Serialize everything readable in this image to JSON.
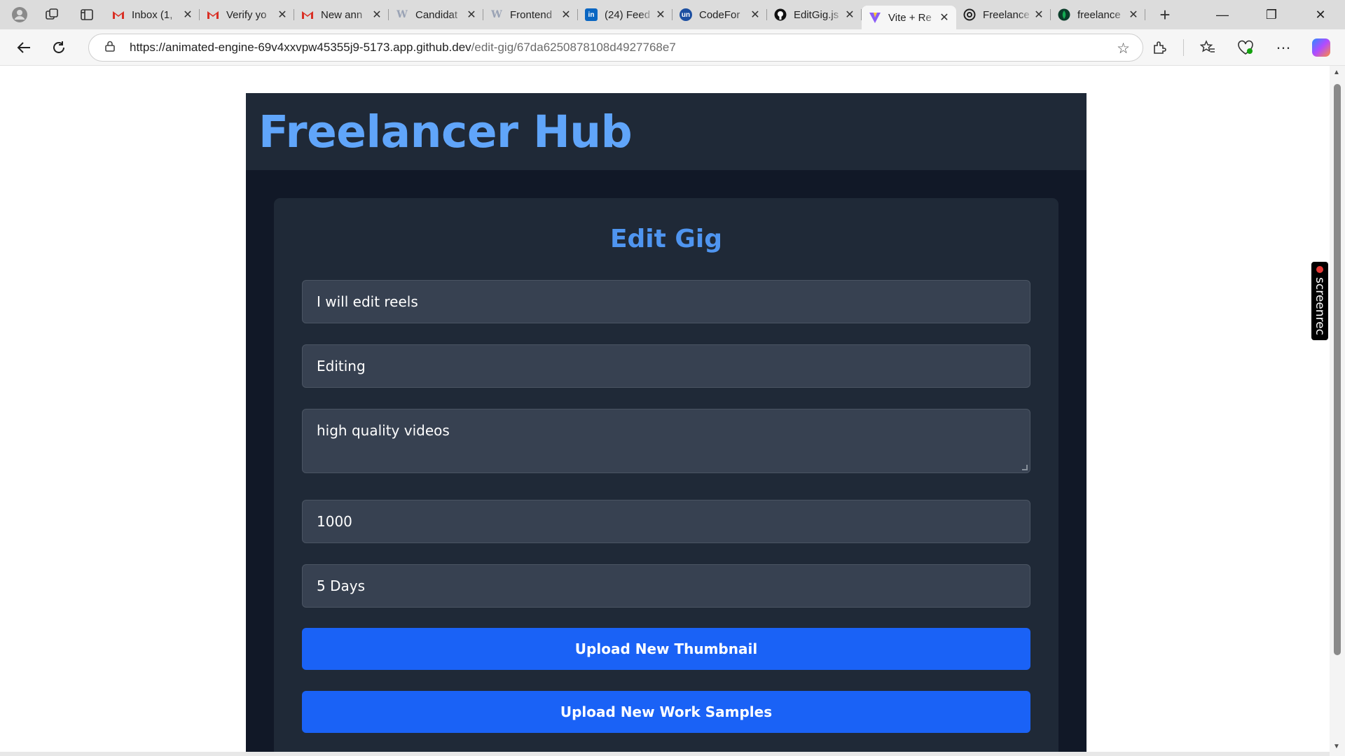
{
  "browser": {
    "tabs": [
      {
        "title": "Inbox (1,",
        "icon": "gmail-icon",
        "color": "#d93025"
      },
      {
        "title": "Verify yo",
        "icon": "gmail-icon",
        "color": "#d93025"
      },
      {
        "title": "New ann",
        "icon": "gmail-icon",
        "color": "#d93025"
      },
      {
        "title": "Candidat",
        "icon": "w-icon",
        "color": "#9aa3b5"
      },
      {
        "title": "Frontend",
        "icon": "w-icon",
        "color": "#9aa3b5"
      },
      {
        "title": "(24) Feed",
        "icon": "linkedin-icon",
        "color": "#0a66c2"
      },
      {
        "title": "CodeFor",
        "icon": "unstop-icon",
        "color": "#1c4fa1"
      },
      {
        "title": "EditGig.js",
        "icon": "github-icon",
        "color": "#111111"
      },
      {
        "title": "Vite + Re",
        "icon": "vite-icon",
        "color": "#8b5cf6"
      },
      {
        "title": "Freelance",
        "icon": "openai-icon",
        "color": "#222222"
      },
      {
        "title": "freelance",
        "icon": "mongodb-icon",
        "color": "#13aa52"
      }
    ],
    "active_tab_index": 8,
    "url_host": "https://animated-engine-69v4xxvpw45355j9-5173.app.github.dev",
    "url_path": "/edit-gig/67da6250878108d4927768e7",
    "screenrec_label": "screenrec"
  },
  "app": {
    "brand": "Freelancer Hub",
    "form": {
      "title": "Edit Gig",
      "gig_title": "I will edit reels",
      "category": "Editing",
      "description": "high quality videos",
      "price": "1000",
      "delivery_time": "5 Days",
      "upload_thumbnail_label": "Upload New Thumbnail",
      "upload_samples_label": "Upload New Work Samples"
    }
  },
  "colors": {
    "app_bg": "#111827",
    "header_bg": "#1f2937",
    "brand": "#60a5fa",
    "input_bg": "#374151",
    "button": "#1a62f6"
  }
}
